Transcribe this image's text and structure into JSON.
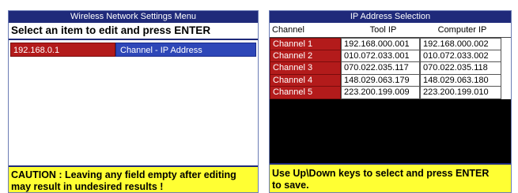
{
  "left_panel": {
    "title": "Wireless Network Settings Menu",
    "instruction": "Select an item to edit and press ENTER",
    "selected_item": {
      "value": "192.168.0.1",
      "label": "Channel - IP Address"
    },
    "caution_line1": "CAUTION : Leaving any field empty after editing",
    "caution_line2": "may result in undesired results !"
  },
  "right_panel": {
    "title": "IP Address Selection",
    "headers": {
      "channel": "Channel",
      "tool_ip": "Tool IP",
      "computer_ip": "Computer IP"
    },
    "rows": [
      {
        "channel": "Channel 1",
        "tool_ip": "192.168.000.001",
        "computer_ip": "192.168.000.002"
      },
      {
        "channel": "Channel 2",
        "tool_ip": "010.072.033.001",
        "computer_ip": "010.072.033.002"
      },
      {
        "channel": "Channel 3",
        "tool_ip": "070.022.035.117",
        "computer_ip": "070.022.035.118"
      },
      {
        "channel": "Channel 4",
        "tool_ip": "148.029.063.179",
        "computer_ip": "148.029.063.180"
      },
      {
        "channel": "Channel 5",
        "tool_ip": "223.200.199.009",
        "computer_ip": "223.200.199.010"
      }
    ],
    "help_line1": "Use Up\\Down keys to select and press ENTER",
    "help_line2": "to save."
  },
  "colors": {
    "title_bar": "#1f2a7a",
    "selected_red": "#b31b1b",
    "highlight_blue": "#2e47b8",
    "footer_yellow": "#ffff33"
  }
}
